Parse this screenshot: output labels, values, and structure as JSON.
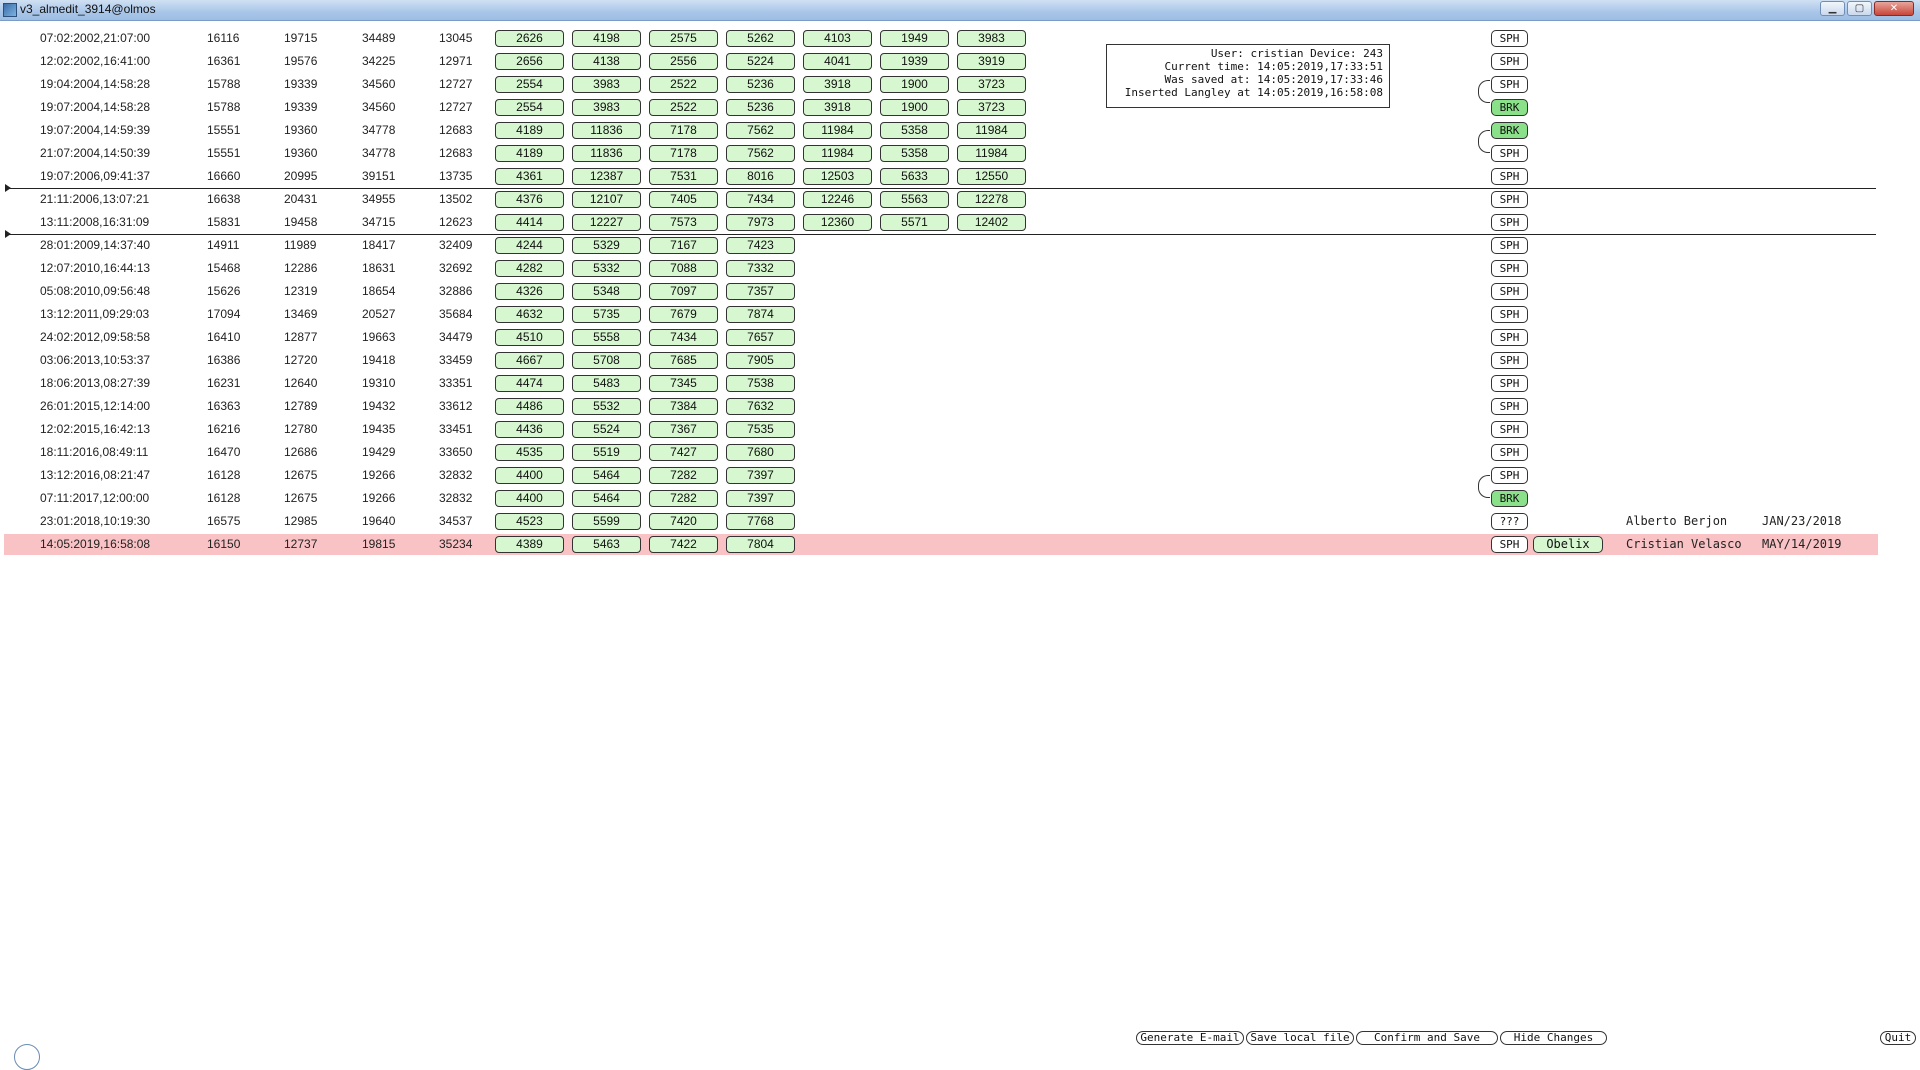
{
  "window": {
    "title": "v3_almedit_3914@olmos"
  },
  "rows": [
    {
      "date": "07:02:2002,21:07:00",
      "n": [
        "16116",
        "19715",
        "34489",
        "13045"
      ],
      "v": [
        "2626",
        "4198",
        "2575",
        "5262",
        "4103",
        "1949",
        "3983"
      ],
      "tag": "SPH"
    },
    {
      "date": "12:02:2002,16:41:00",
      "n": [
        "16361",
        "19576",
        "34225",
        "12971"
      ],
      "v": [
        "2656",
        "4138",
        "2556",
        "5224",
        "4041",
        "1939",
        "3919"
      ],
      "tag": "SPH"
    },
    {
      "date": "19:04:2004,14:58:28",
      "n": [
        "15788",
        "19339",
        "34560",
        "12727"
      ],
      "v": [
        "2554",
        "3983",
        "2522",
        "5236",
        "3918",
        "1900",
        "3723"
      ],
      "tag": "SPH"
    },
    {
      "date": "19:07:2004,14:58:28",
      "n": [
        "15788",
        "19339",
        "34560",
        "12727"
      ],
      "v": [
        "2554",
        "3983",
        "2522",
        "5236",
        "3918",
        "1900",
        "3723"
      ],
      "tag": "BRK"
    },
    {
      "date": "19:07:2004,14:59:39",
      "n": [
        "15551",
        "19360",
        "34778",
        "12683"
      ],
      "v": [
        "4189",
        "11836",
        "7178",
        "7562",
        "11984",
        "5358",
        "11984"
      ],
      "tag": "BRK"
    },
    {
      "date": "21:07:2004,14:50:39",
      "n": [
        "15551",
        "19360",
        "34778",
        "12683"
      ],
      "v": [
        "4189",
        "11836",
        "7178",
        "7562",
        "11984",
        "5358",
        "11984"
      ],
      "tag": "SPH"
    },
    {
      "date": "19:07:2006,09:41:37",
      "n": [
        "16660",
        "20995",
        "39151",
        "13735"
      ],
      "v": [
        "4361",
        "12387",
        "7531",
        "8016",
        "12503",
        "5633",
        "12550"
      ],
      "tag": "SPH"
    },
    {
      "date": "21:11:2006,13:07:21",
      "n": [
        "16638",
        "20431",
        "34955",
        "13502"
      ],
      "v": [
        "4376",
        "12107",
        "7405",
        "7434",
        "12246",
        "5563",
        "12278"
      ],
      "tag": "SPH"
    },
    {
      "date": "13:11:2008,16:31:09",
      "n": [
        "15831",
        "19458",
        "34715",
        "12623"
      ],
      "v": [
        "4414",
        "12227",
        "7573",
        "7973",
        "12360",
        "5571",
        "12402"
      ],
      "tag": "SPH"
    },
    {
      "date": "28:01:2009,14:37:40",
      "n": [
        "14911",
        "11989",
        "18417",
        "32409"
      ],
      "v": [
        "4244",
        "5329",
        "7167",
        "7423"
      ],
      "tag": "SPH"
    },
    {
      "date": "12:07:2010,16:44:13",
      "n": [
        "15468",
        "12286",
        "18631",
        "32692"
      ],
      "v": [
        "4282",
        "5332",
        "7088",
        "7332"
      ],
      "tag": "SPH"
    },
    {
      "date": "05:08:2010,09:56:48",
      "n": [
        "15626",
        "12319",
        "18654",
        "32886"
      ],
      "v": [
        "4326",
        "5348",
        "7097",
        "7357"
      ],
      "tag": "SPH"
    },
    {
      "date": "13:12:2011,09:29:03",
      "n": [
        "17094",
        "13469",
        "20527",
        "35684"
      ],
      "v": [
        "4632",
        "5735",
        "7679",
        "7874"
      ],
      "tag": "SPH"
    },
    {
      "date": "24:02:2012,09:58:58",
      "n": [
        "16410",
        "12877",
        "19663",
        "34479"
      ],
      "v": [
        "4510",
        "5558",
        "7434",
        "7657"
      ],
      "tag": "SPH"
    },
    {
      "date": "03:06:2013,10:53:37",
      "n": [
        "16386",
        "12720",
        "19418",
        "33459"
      ],
      "v": [
        "4667",
        "5708",
        "7685",
        "7905"
      ],
      "tag": "SPH"
    },
    {
      "date": "18:06:2013,08:27:39",
      "n": [
        "16231",
        "12640",
        "19310",
        "33351"
      ],
      "v": [
        "4474",
        "5483",
        "7345",
        "7538"
      ],
      "tag": "SPH"
    },
    {
      "date": "26:01:2015,12:14:00",
      "n": [
        "16363",
        "12789",
        "19432",
        "33612"
      ],
      "v": [
        "4486",
        "5532",
        "7384",
        "7632"
      ],
      "tag": "SPH"
    },
    {
      "date": "12:02:2015,16:42:13",
      "n": [
        "16216",
        "12780",
        "19435",
        "33451"
      ],
      "v": [
        "4436",
        "5524",
        "7367",
        "7535"
      ],
      "tag": "SPH"
    },
    {
      "date": "18:11:2016,08:49:11",
      "n": [
        "16470",
        "12686",
        "19429",
        "33650"
      ],
      "v": [
        "4535",
        "5519",
        "7427",
        "7680"
      ],
      "tag": "SPH"
    },
    {
      "date": "13:12:2016,08:21:47",
      "n": [
        "16128",
        "12675",
        "19266",
        "32832"
      ],
      "v": [
        "4400",
        "5464",
        "7282",
        "7397"
      ],
      "tag": "SPH"
    },
    {
      "date": "07:11:2017,12:00:00",
      "n": [
        "16128",
        "12675",
        "19266",
        "32832"
      ],
      "v": [
        "4400",
        "5464",
        "7282",
        "7397"
      ],
      "tag": "BRK"
    },
    {
      "date": "23:01:2018,10:19:30",
      "n": [
        "16575",
        "12985",
        "19640",
        "34537"
      ],
      "v": [
        "4523",
        "5599",
        "7420",
        "7768"
      ],
      "tag": "???",
      "user": "Alberto Berjon",
      "udate": "JAN/23/2018"
    },
    {
      "date": "14:05:2019,16:58:08",
      "n": [
        "16150",
        "12737",
        "19815",
        "35234"
      ],
      "v": [
        "4389",
        "5463",
        "7422",
        "7804"
      ],
      "tag": "SPH",
      "extra": "Obelix",
      "user": "Cristian Velasco",
      "udate": "MAY/14/2019"
    }
  ],
  "info": {
    "user_line": "User: cristian Device: 243",
    "current_time": "Current time: 14:05:2019,17:33:51",
    "saved_at": "Was saved at: 14:05:2019,17:33:46",
    "inserted": "Inserted Langley at 14:05:2019,16:58:08"
  },
  "buttons": {
    "generate_email": "Generate E-mail",
    "save_local": "Save local file",
    "confirm_save": "Confirm and Save",
    "hide_changes": "Hide Changes",
    "quit": "Quit"
  },
  "colors": {
    "value_button": "#d6f7cf",
    "brk_tag": "#8be08a",
    "highlight_row": "#f9c2c5",
    "titlebar": "#a9c6e8"
  }
}
